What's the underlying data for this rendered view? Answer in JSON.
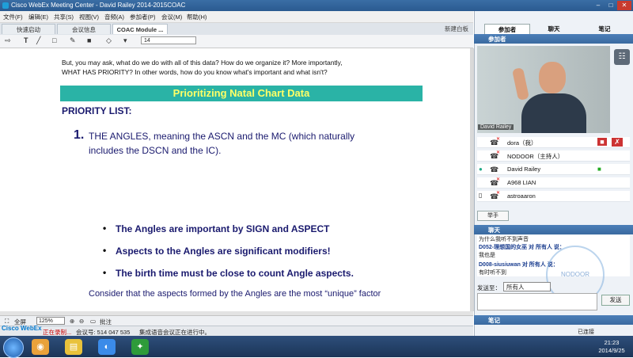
{
  "window": {
    "title": "Cisco WebEx Meeting Center - David Railey 2014-2015COAC",
    "controls": [
      "–",
      "□",
      "✕"
    ]
  },
  "menu": [
    "文件(F)",
    "编辑(E)",
    "共享(S)",
    "视图(V)",
    "音频(A)",
    "参加者(P)",
    "会议(M)",
    "帮助(H)"
  ],
  "tabs": [
    {
      "label": "快速启动",
      "active": false
    },
    {
      "label": "会议信息",
      "active": false
    },
    {
      "label": "COAC Module ...",
      "active": true
    }
  ],
  "share_tab": "新建白板",
  "toolbar": {
    "font_size": "14"
  },
  "document": {
    "intro_line1": "But, you may ask, what do we do with all of this data?  How do we organize it?  More importantly,",
    "intro_line2": "WHAT HAS PRIORITY?  In other words, how do you know what's important and what isn't?",
    "banner": "Prioritizing Natal Chart Data",
    "priority_heading": "PRIORITY LIST:",
    "item_number": "1.",
    "item1_line1": "THE ANGLES, meaning the ASCN and the MC (which naturally",
    "item1_line2": "includes the DSCN and the IC).",
    "bullets": [
      "The Angles are important by SIGN and ASPECT",
      "Aspects to the Angles are significant modifiers!",
      "The birth time must be close to count Angle aspects."
    ],
    "consider": "Consider that the aspects formed by the Angles are the most “unique” factor"
  },
  "zoombar": {
    "fullscreen": "全屏",
    "zoom": "125%",
    "comment": "批注"
  },
  "status": {
    "recording": "正在录制...",
    "meeting_number": "会议号: 514 047 535",
    "audio_status": "集成语音会议正在进行中。"
  },
  "panel": {
    "tabs": [
      "参加者",
      "聊天",
      "笔记"
    ],
    "participants_header": "参加者",
    "video_name": "David Railey",
    "participants": [
      {
        "name": "dora（我）"
      },
      {
        "name": "NODOOR（主持人）"
      },
      {
        "name": "David Railey"
      },
      {
        "name": "A968 LIAN"
      },
      {
        "name": "astroaaron"
      }
    ],
    "raise_hand": "举手",
    "chat_header": "聊天",
    "chat_lines": [
      "为什么我听不到声音",
      "D052-理想国的女巫 对 所有人 说：",
      "我也是",
      "D008-siusiuwan 对 所有人 说：",
      "有时听不到"
    ],
    "send_to_label": "发送至：",
    "send_to_value": "所有人",
    "send_button": "发送",
    "notes_header": "笔记",
    "lock_status": "已连接",
    "watermark": "NODOOR"
  },
  "taskbar": {
    "time": "21:23",
    "date": "2014/9/25"
  },
  "brand": {
    "webex": "Cisco WebEx"
  },
  "colors": {
    "banner_bg": "#2ab3a6",
    "banner_text": "#ffff66",
    "navy_text": "#1a1a6e",
    "panel_header": "#3a6aa0"
  },
  "icons": [
    "search-icon",
    "camera-icon",
    "phone-icon",
    "chevron-down-icon"
  ]
}
